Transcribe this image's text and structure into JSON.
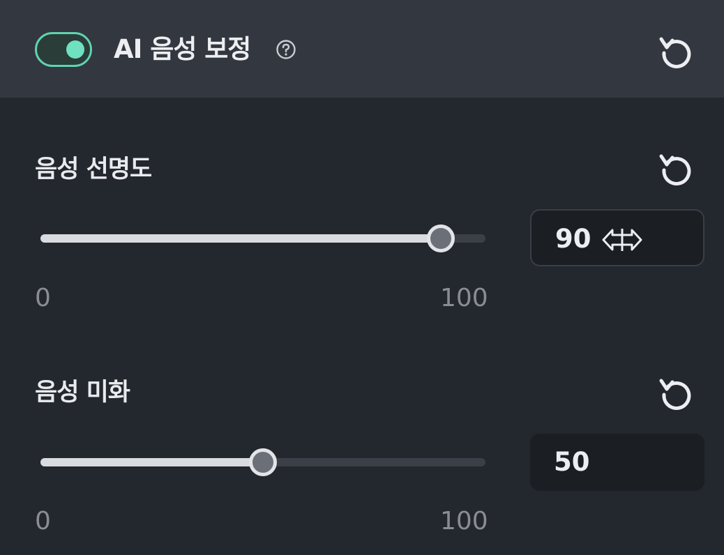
{
  "header": {
    "toggle_on": true,
    "title": "AI 음성 보정",
    "help_icon": "question-circle-icon",
    "reset_icon": "reset-icon"
  },
  "clarity": {
    "label": "음성 선명도",
    "value": 90,
    "value_text": "90",
    "min": 0,
    "max": 100,
    "min_label": "0",
    "max_label": "100",
    "cursor_icon": "horizontal-resize-cursor-icon"
  },
  "beautify": {
    "label": "음성 미화",
    "value": 50,
    "value_text": "50",
    "min": 0,
    "max": 100,
    "min_label": "0",
    "max_label": "100"
  },
  "colors": {
    "accent": "#5fd3b0",
    "panel_bg": "#23272e",
    "header_bg": "#33373f"
  }
}
